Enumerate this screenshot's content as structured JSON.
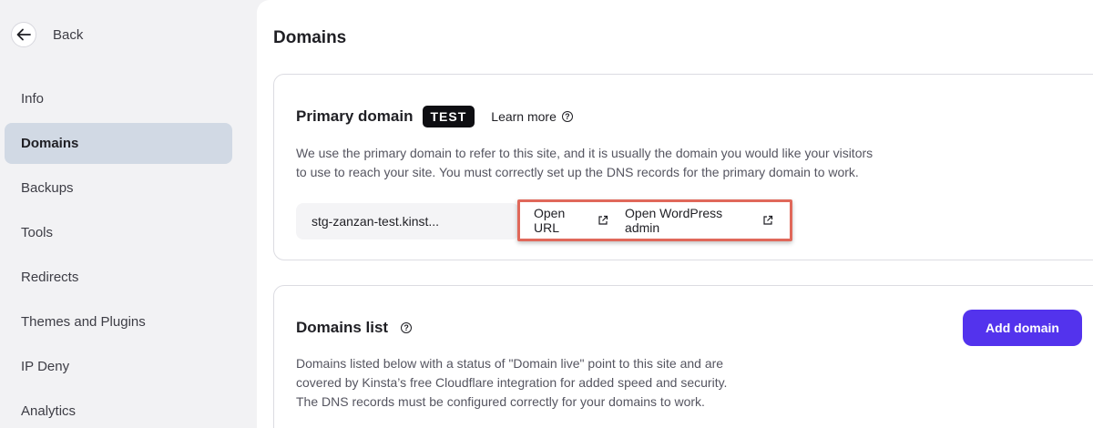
{
  "sidebar": {
    "back_label": "Back",
    "items": [
      {
        "label": "Info"
      },
      {
        "label": "Domains",
        "active": true
      },
      {
        "label": "Backups"
      },
      {
        "label": "Tools"
      },
      {
        "label": "Redirects"
      },
      {
        "label": "Themes and Plugins"
      },
      {
        "label": "IP Deny"
      },
      {
        "label": "Analytics"
      }
    ]
  },
  "main": {
    "title": "Domains",
    "primary_domain": {
      "title": "Primary domain",
      "badge": "TEST",
      "learn_more": "Learn more",
      "description_line1": "We use the primary domain to refer to this site, and it is usually the domain you would like your visitors",
      "description_line2": "to use to reach your site. You must correctly set up the DNS records for the primary domain to work.",
      "domain_value": "stg-zanzan-test.kinst...",
      "open_url_label": "Open URL",
      "open_wp_admin_label": "Open WordPress admin"
    },
    "domains_list": {
      "title": "Domains list",
      "add_domain_label": "Add domain",
      "description_line1": "Domains listed below with a status of \"Domain live\" point to this site and are",
      "description_line2": "covered by Kinsta’s free Cloudflare integration for added speed and security.",
      "description_line3": "The DNS records must be configured correctly for your domains to work."
    }
  },
  "colors": {
    "accent": "#5333ed",
    "highlight": "#e0685a",
    "active_nav_bg": "#d1d9e4",
    "badge_bg": "#0e0e12"
  },
  "icons": {
    "back": "arrow-left-icon",
    "help": "question-circle-icon",
    "external": "external-link-icon"
  }
}
